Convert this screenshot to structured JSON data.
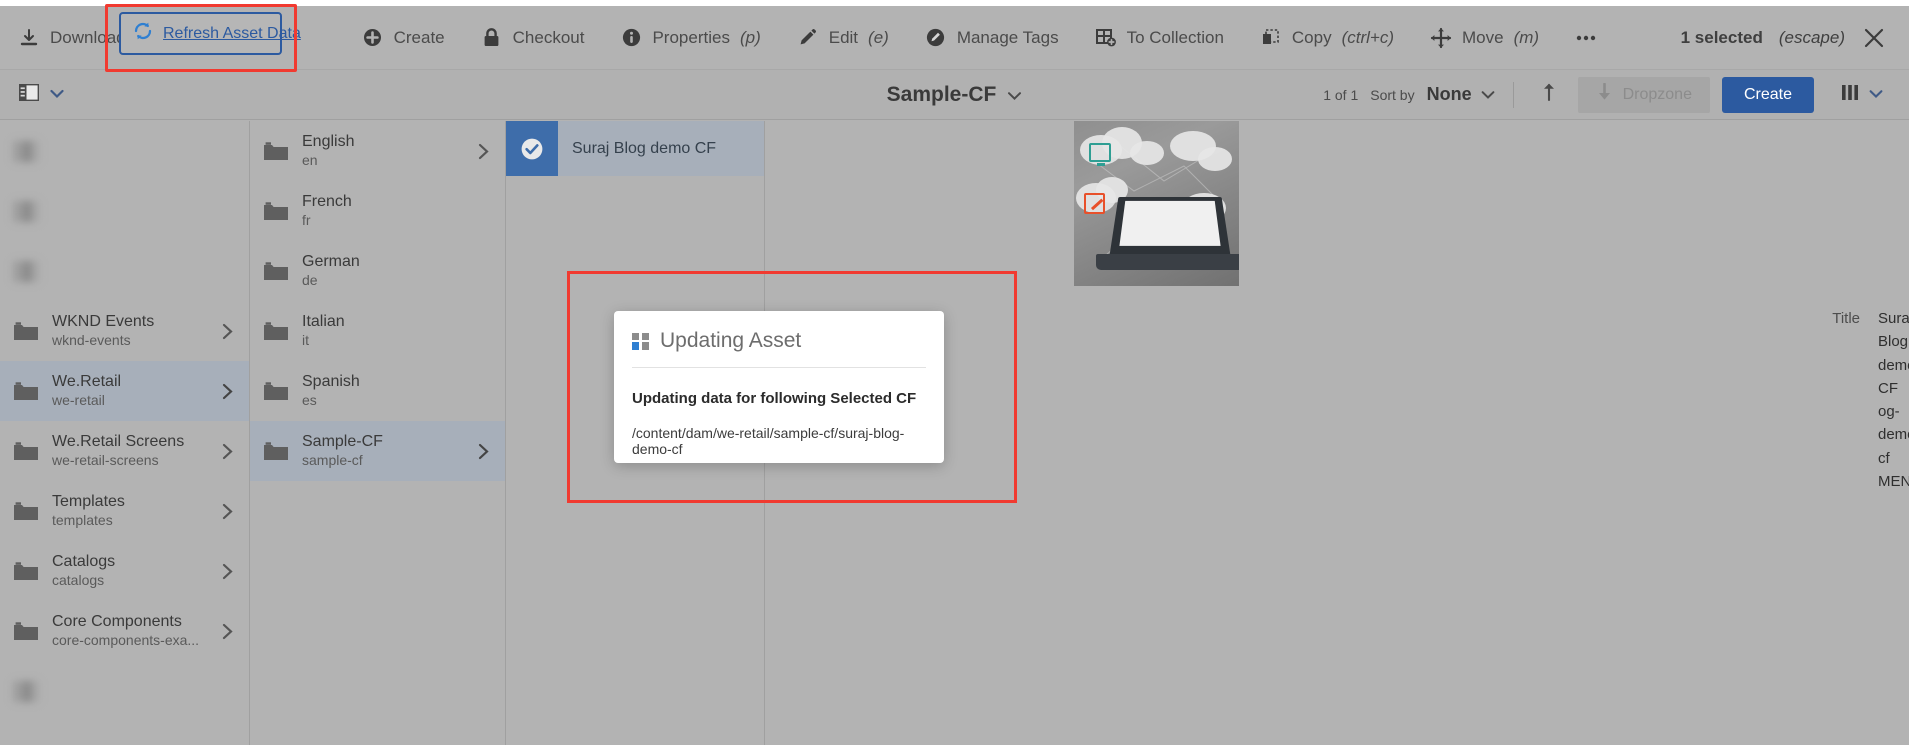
{
  "toolbar": {
    "actions": [
      {
        "label": "Download",
        "shortcut": "",
        "icon": "download-icon"
      },
      {
        "label": "Create",
        "shortcut": "",
        "icon": "plus-circle-icon"
      },
      {
        "label": "Checkout",
        "shortcut": "",
        "icon": "lock-icon"
      },
      {
        "label": "Properties",
        "shortcut": "(p)",
        "icon": "info-icon"
      },
      {
        "label": "Edit",
        "shortcut": "(e)",
        "icon": "pencil-icon"
      },
      {
        "label": "Manage Tags",
        "shortcut": "",
        "icon": "tag-edit-icon"
      },
      {
        "label": "To Collection",
        "shortcut": "",
        "icon": "collection-add-icon"
      },
      {
        "label": "Copy",
        "shortcut": "(ctrl+c)",
        "icon": "copy-icon"
      },
      {
        "label": "Move",
        "shortcut": "(m)",
        "icon": "move-icon"
      },
      {
        "label": "",
        "shortcut": "",
        "icon": "more-ellipsis-icon"
      }
    ],
    "refresh": {
      "label": "Refresh Asset Data",
      "icon": "refresh-icon",
      "accent": "#2c5aa0",
      "highlight": "#f13a30"
    },
    "selection": {
      "count": "1 selected",
      "shortcut": "(escape)",
      "close_icon": "close-icon"
    }
  },
  "subbar": {
    "rail_toggle_icon": "layout-rail-icon",
    "breadcrumb": "Sample-CF",
    "pager": "1 of 1",
    "sort_by_label": "Sort by",
    "sort_by_value": "None",
    "sort_direction_icon": "arrow-up-icon",
    "dropzone_label": "Dropzone",
    "create_label": "Create",
    "view_icon": "column-view-icon"
  },
  "columns": {
    "col1": [
      {
        "title": "",
        "path": "",
        "redacted": true,
        "selected": false,
        "has_children": false
      },
      {
        "title": "",
        "path": "",
        "redacted": true,
        "selected": false,
        "has_children": false
      },
      {
        "title": "",
        "path": "",
        "redacted": true,
        "selected": false,
        "has_children": false
      },
      {
        "title": "WKND Events",
        "path": "wknd-events",
        "redacted": false,
        "selected": false,
        "has_children": true
      },
      {
        "title": "We.Retail",
        "path": "we-retail",
        "redacted": false,
        "selected": true,
        "has_children": true
      },
      {
        "title": "We.Retail Screens",
        "path": "we-retail-screens",
        "redacted": false,
        "selected": false,
        "has_children": true
      },
      {
        "title": "Templates",
        "path": "templates",
        "redacted": false,
        "selected": false,
        "has_children": true
      },
      {
        "title": "Catalogs",
        "path": "catalogs",
        "redacted": false,
        "selected": false,
        "has_children": true
      },
      {
        "title": "Core Components",
        "path": "core-components-exa...",
        "redacted": false,
        "selected": false,
        "has_children": true
      },
      {
        "title": "",
        "path": "",
        "redacted": true,
        "selected": false,
        "has_children": false
      }
    ],
    "col2": [
      {
        "title": "English",
        "path": "en",
        "selected": false,
        "has_children": true
      },
      {
        "title": "French",
        "path": "fr",
        "selected": false,
        "has_children": false
      },
      {
        "title": "German",
        "path": "de",
        "selected": false,
        "has_children": false
      },
      {
        "title": "Italian",
        "path": "it",
        "selected": false,
        "has_children": false
      },
      {
        "title": "Spanish",
        "path": "es",
        "selected": false,
        "has_children": false
      },
      {
        "title": "Sample-CF",
        "path": "sample-cf",
        "selected": true,
        "has_children": true
      }
    ],
    "col3": [
      {
        "title": "Suraj Blog demo CF",
        "selected": true,
        "check_icon": "check-circle-icon"
      }
    ]
  },
  "detail": {
    "thumbnail_alt": "content-fragment-thumbnail",
    "metadata": [
      {
        "key": "Title",
        "value": "Suraj Blog demo CF"
      },
      {
        "key": "",
        "value": "og-demo-cf"
      },
      {
        "key": "",
        "value": "MENT"
      }
    ]
  },
  "modal": {
    "icon": "page-grid-icon",
    "title": "Updating Asset",
    "message": "Updating data for following Selected CF",
    "path": "/content/dam/we-retail/sample-cf/suraj-blog-demo-cf"
  },
  "colors": {
    "accent_blue": "#2c5aa0",
    "highlight_red": "#f13a30",
    "chrome_gray": "#b3b3b3",
    "selected_row": "#a7afba",
    "check_blue": "#3e6daa"
  }
}
